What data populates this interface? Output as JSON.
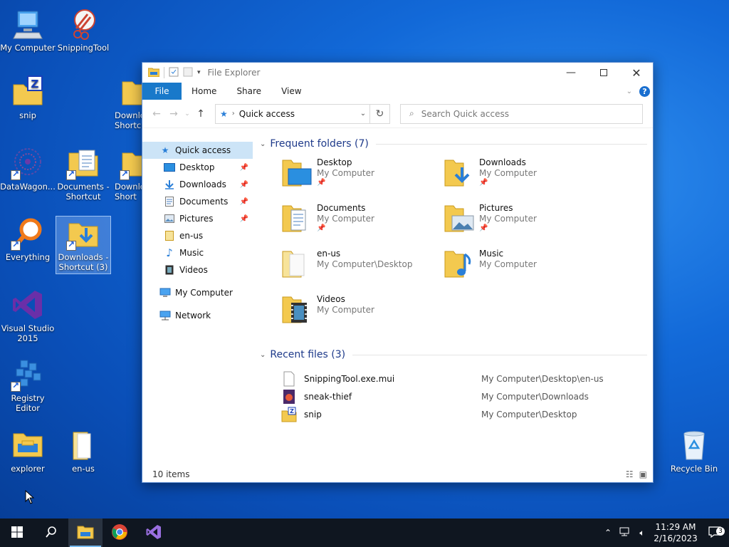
{
  "desktop": {
    "icons": {
      "my_computer": "My Computer",
      "snipping_tool": "SnippingTool",
      "snip": "snip",
      "downloads_shortcut_1": "Downlo",
      "downloads_shortcut_1b": "Shortcu",
      "datawagon": "DataWagon...",
      "documents_shortcut": "Documents -",
      "documents_shortcut_b": "Shortcut",
      "downloads_shortcut_2": "Downlo",
      "downloads_shortcut_2b": "Short",
      "everything": "Everything",
      "downloads_shortcut_3": "Downloads -",
      "downloads_shortcut_3b": "Shortcut (3)",
      "visual_studio": "Visual Studio",
      "visual_studio_b": "2015",
      "registry_editor": "Registry",
      "registry_editor_b": "Editor",
      "explorer": "explorer",
      "en_us": "en-us",
      "recycle_bin": "Recycle Bin"
    }
  },
  "window": {
    "title": "File Explorer",
    "ribbon": {
      "file": "File",
      "home": "Home",
      "share": "Share",
      "view": "View"
    },
    "address": "Quick access",
    "search_placeholder": "Search Quick access",
    "nav": {
      "quick_access": "Quick access",
      "desktop": "Desktop",
      "downloads": "Downloads",
      "documents": "Documents",
      "pictures": "Pictures",
      "en_us": "en-us",
      "music": "Music",
      "videos": "Videos",
      "my_computer": "My Computer",
      "network": "Network"
    },
    "frequent_header": "Frequent folders (7)",
    "folders": [
      {
        "name": "Desktop",
        "sub": "My Computer",
        "pinned": true
      },
      {
        "name": "Downloads",
        "sub": "My Computer",
        "pinned": true
      },
      {
        "name": "Documents",
        "sub": "My Computer",
        "pinned": true
      },
      {
        "name": "Pictures",
        "sub": "My Computer",
        "pinned": true
      },
      {
        "name": "en-us",
        "sub": "My Computer\\Desktop",
        "pinned": false
      },
      {
        "name": "Music",
        "sub": "My Computer",
        "pinned": false
      },
      {
        "name": "Videos",
        "sub": "My Computer",
        "pinned": false
      }
    ],
    "recent_header": "Recent files (3)",
    "recent": [
      {
        "name": "SnippingTool.exe.mui",
        "path": "My Computer\\Desktop\\en-us"
      },
      {
        "name": "sneak-thief",
        "path": "My Computer\\Downloads"
      },
      {
        "name": "snip",
        "path": "My Computer\\Desktop"
      }
    ],
    "status": "10 items"
  },
  "taskbar": {
    "time": "11:29 AM",
    "date": "2/16/2023",
    "notification_count": "3"
  },
  "colors": {
    "accent": "#1979ca",
    "folder": "#f3c94f",
    "nav_selected": "#cce4f7",
    "taskbar": "#0f1620"
  }
}
